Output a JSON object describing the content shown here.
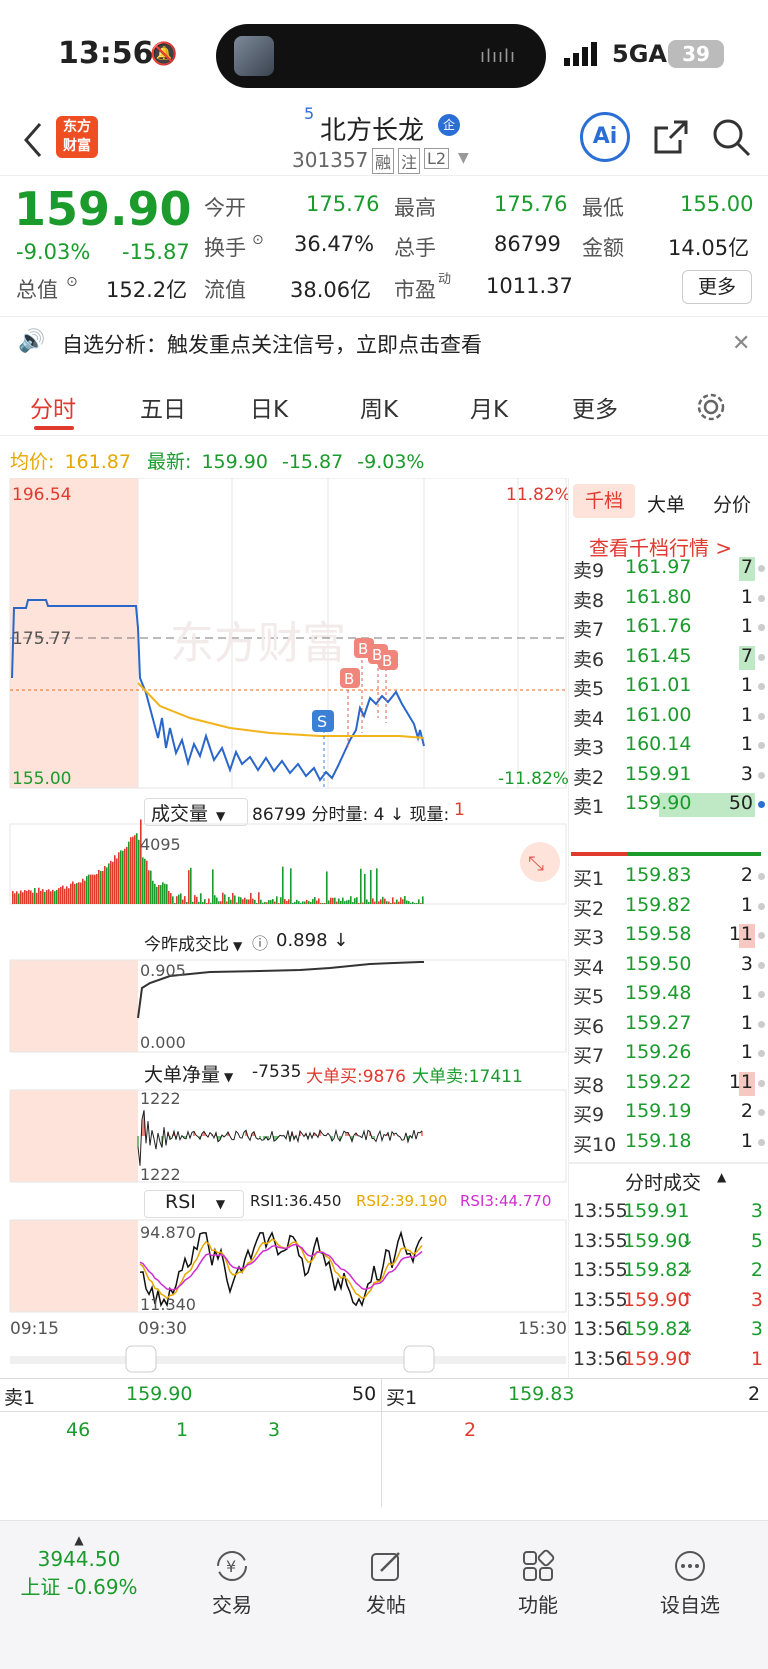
{
  "status": {
    "time": "13:56",
    "network": "5GA",
    "battery": "39"
  },
  "nav": {
    "logo_line1": "东方",
    "logo_line2": "财富",
    "badge": "5",
    "name": "北方长龙",
    "corp_tag": "企",
    "code": "301357",
    "tag_rong": "融",
    "tag_zhu": "注",
    "tag_l2": "L2",
    "ai_label": "Ai"
  },
  "quote": {
    "price": "159.90",
    "change_pct": "-9.03%",
    "change": "-15.87",
    "open_label": "今开",
    "open": "175.76",
    "high_label": "最高",
    "high": "175.76",
    "low_label": "最低",
    "low": "155.00",
    "turnover_label": "换手",
    "turnover": "36.47%",
    "volume_label": "总手",
    "volume": "86799",
    "amount_label": "金额",
    "amount": "14.05亿",
    "mcap_label": "总值",
    "mcap": "152.2亿",
    "float_label": "流值",
    "float": "38.06亿",
    "pe_label": "市盈",
    "pe_sup": "动",
    "pe": "1011.37",
    "more": "更多"
  },
  "notice": {
    "text": "自选分析：触发重点关注信号，立即点击查看"
  },
  "tabs": [
    "分时",
    "五日",
    "日K",
    "周K",
    "月K",
    "更多"
  ],
  "avg": {
    "avg_label": "均价:",
    "avg": "161.87",
    "latest_label": "最新:",
    "latest": "159.90",
    "chg": "-15.87",
    "chg_pct": "-9.03%"
  },
  "chart_data": {
    "type": "line",
    "y_top": "196.54",
    "y_bottom": "155.00",
    "y_ref": "175.77",
    "pct_top": "11.82%",
    "pct_bottom": "-11.82%",
    "watermark": "东方财富",
    "x_labels": [
      "09:15",
      "09:30",
      "15:30"
    ],
    "signals": [
      "S",
      "B",
      "B",
      "B",
      "B"
    ],
    "volume_panel": {
      "label": "成交量",
      "info": "86799 分时量: 4 ↓ 现量: ",
      "now": "1",
      "axis_top": "4095"
    },
    "ratio_panel": {
      "label": "今昨成交比",
      "value": "0.898 ↓",
      "axis_top": "0.905",
      "axis_bottom": "0.000"
    },
    "bigorder_panel": {
      "label": "大单净量",
      "net": "-7535",
      "buy": "大单买:9876",
      "sell": "大单卖:17411",
      "axis_top": "1222",
      "axis_bottom": "1222"
    },
    "rsi_panel": {
      "label": "RSI",
      "rsi1": "RSI1:36.450",
      "rsi2": "RSI2:39.190",
      "rsi3": "RSI3:44.770",
      "axis_top": "94.870",
      "axis_bottom": "11.340"
    }
  },
  "book": {
    "tabs": [
      "千档",
      "大单",
      "分价"
    ],
    "link": "查看千档行情 >",
    "asks": [
      {
        "label": "卖9",
        "price": "161.97",
        "qty": "7"
      },
      {
        "label": "卖8",
        "price": "161.80",
        "qty": "1"
      },
      {
        "label": "卖7",
        "price": "161.76",
        "qty": "1"
      },
      {
        "label": "卖6",
        "price": "161.45",
        "qty": "7"
      },
      {
        "label": "卖5",
        "price": "161.01",
        "qty": "1"
      },
      {
        "label": "卖4",
        "price": "161.00",
        "qty": "1"
      },
      {
        "label": "卖3",
        "price": "160.14",
        "qty": "1"
      },
      {
        "label": "卖2",
        "price": "159.91",
        "qty": "3"
      },
      {
        "label": "卖1",
        "price": "159.90",
        "qty": "50"
      }
    ],
    "bids": [
      {
        "label": "买1",
        "price": "159.83",
        "qty": "2"
      },
      {
        "label": "买2",
        "price": "159.82",
        "qty": "1"
      },
      {
        "label": "买3",
        "price": "159.58",
        "qty": "11"
      },
      {
        "label": "买4",
        "price": "159.50",
        "qty": "3"
      },
      {
        "label": "买5",
        "price": "159.48",
        "qty": "1"
      },
      {
        "label": "买6",
        "price": "159.27",
        "qty": "1"
      },
      {
        "label": "买7",
        "price": "159.26",
        "qty": "1"
      },
      {
        "label": "买8",
        "price": "159.22",
        "qty": "11"
      },
      {
        "label": "买9",
        "price": "159.19",
        "qty": "2"
      },
      {
        "label": "买10",
        "price": "159.18",
        "qty": "1"
      }
    ],
    "trades_title": "分时成交",
    "trades": [
      {
        "time": "13:55",
        "price": "159.91",
        "arrow": "",
        "qty": "3",
        "dir": "g"
      },
      {
        "time": "13:55",
        "price": "159.90",
        "arrow": "↓",
        "qty": "5",
        "dir": "g"
      },
      {
        "time": "13:55",
        "price": "159.82",
        "arrow": "↓",
        "qty": "2",
        "dir": "g"
      },
      {
        "time": "13:55",
        "price": "159.90",
        "arrow": "↑",
        "qty": "3",
        "dir": "r"
      },
      {
        "time": "13:56",
        "price": "159.82",
        "arrow": "↓",
        "qty": "3",
        "dir": "g"
      },
      {
        "time": "13:56",
        "price": "159.90",
        "arrow": "↑",
        "qty": "1",
        "dir": "r"
      }
    ]
  },
  "bottom_quote": {
    "ask_label": "卖1",
    "ask_price": "159.90",
    "ask_qty": "50",
    "ask_parts": [
      "46",
      "1",
      "3"
    ],
    "bid_label": "买1",
    "bid_price": "159.83",
    "bid_qty": "2",
    "bid_parts": [
      "2"
    ]
  },
  "bottom_bar": {
    "index_value": "3944.50",
    "index_label": "上证 -0.69%",
    "items": [
      "交易",
      "发帖",
      "功能",
      "设自选"
    ]
  }
}
